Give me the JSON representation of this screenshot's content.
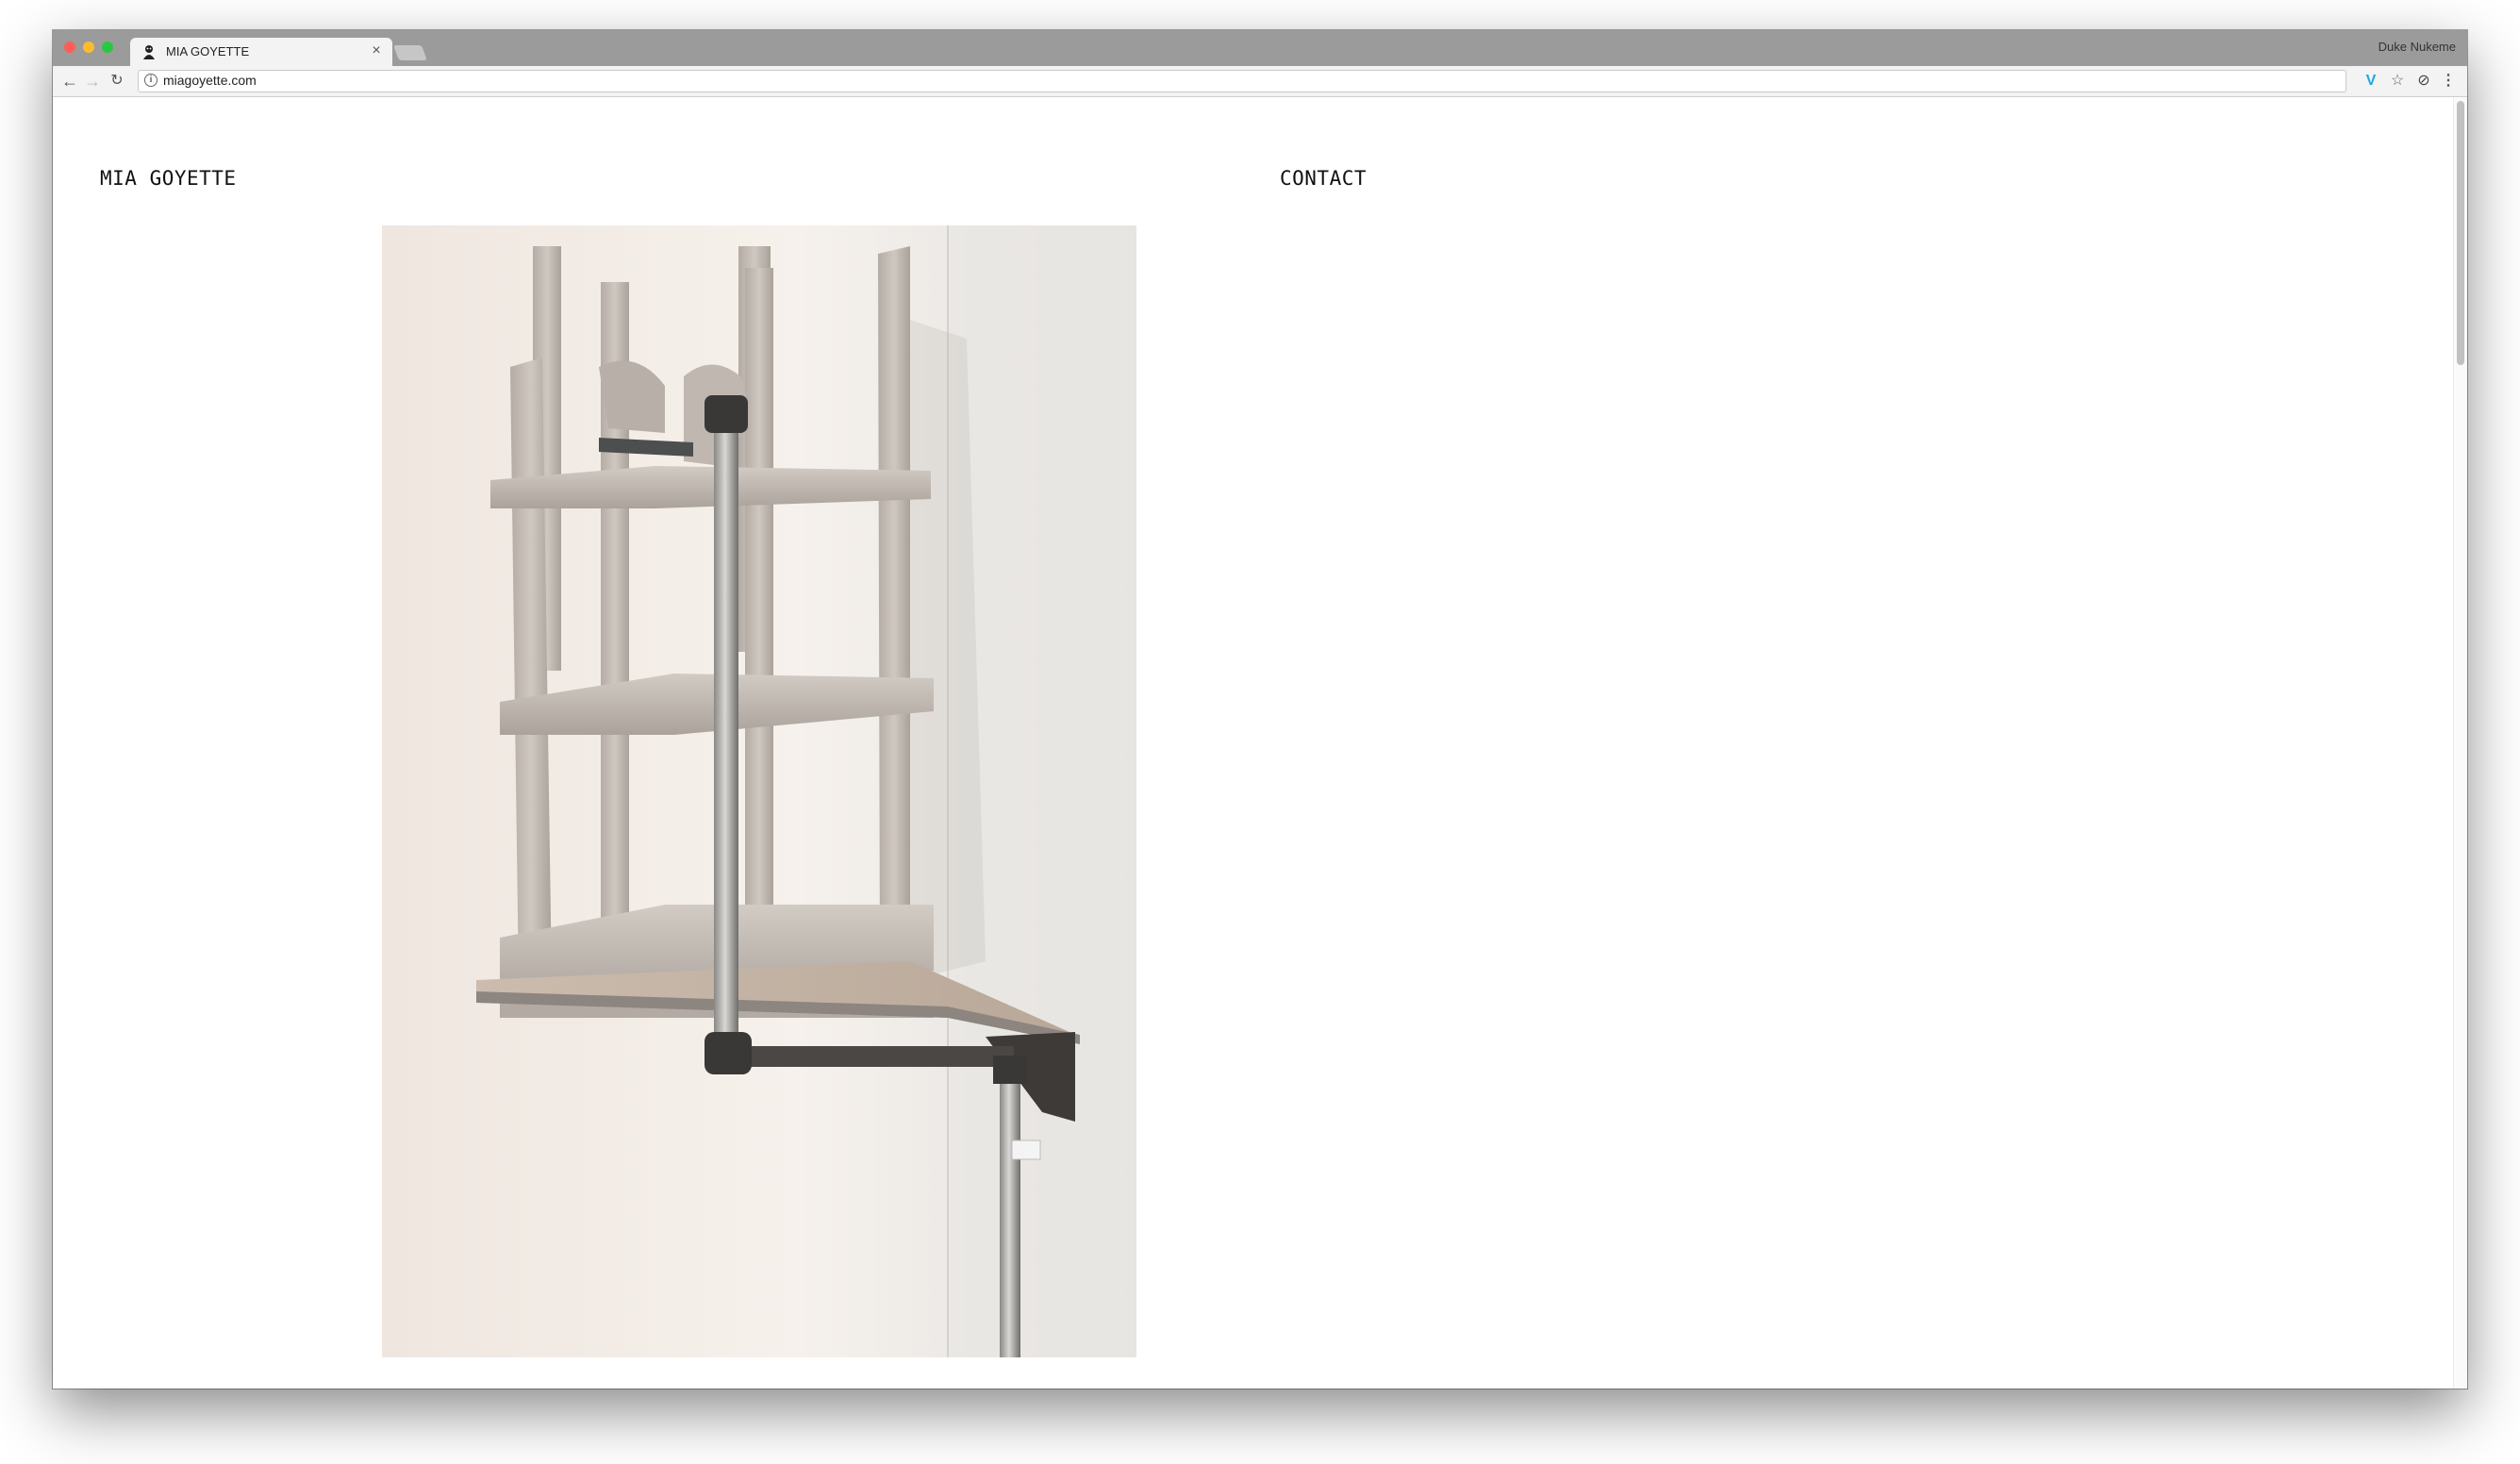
{
  "browser": {
    "tab_title": "MIA GOYETTE",
    "tab_close": "×",
    "profile_name": "Duke Nukeme",
    "url": "miagoyette.com",
    "icons": [
      "back-icon",
      "forward-icon",
      "reload-icon",
      "info-icon",
      "vimeo-icon",
      "star-icon",
      "extension-icon",
      "menu-icon"
    ],
    "traffic_colors": [
      "#fc5f57",
      "#fdbc2e",
      "#28c840"
    ]
  },
  "site": {
    "title": "MIA GOYETTE",
    "nav_contact": "CONTACT"
  }
}
